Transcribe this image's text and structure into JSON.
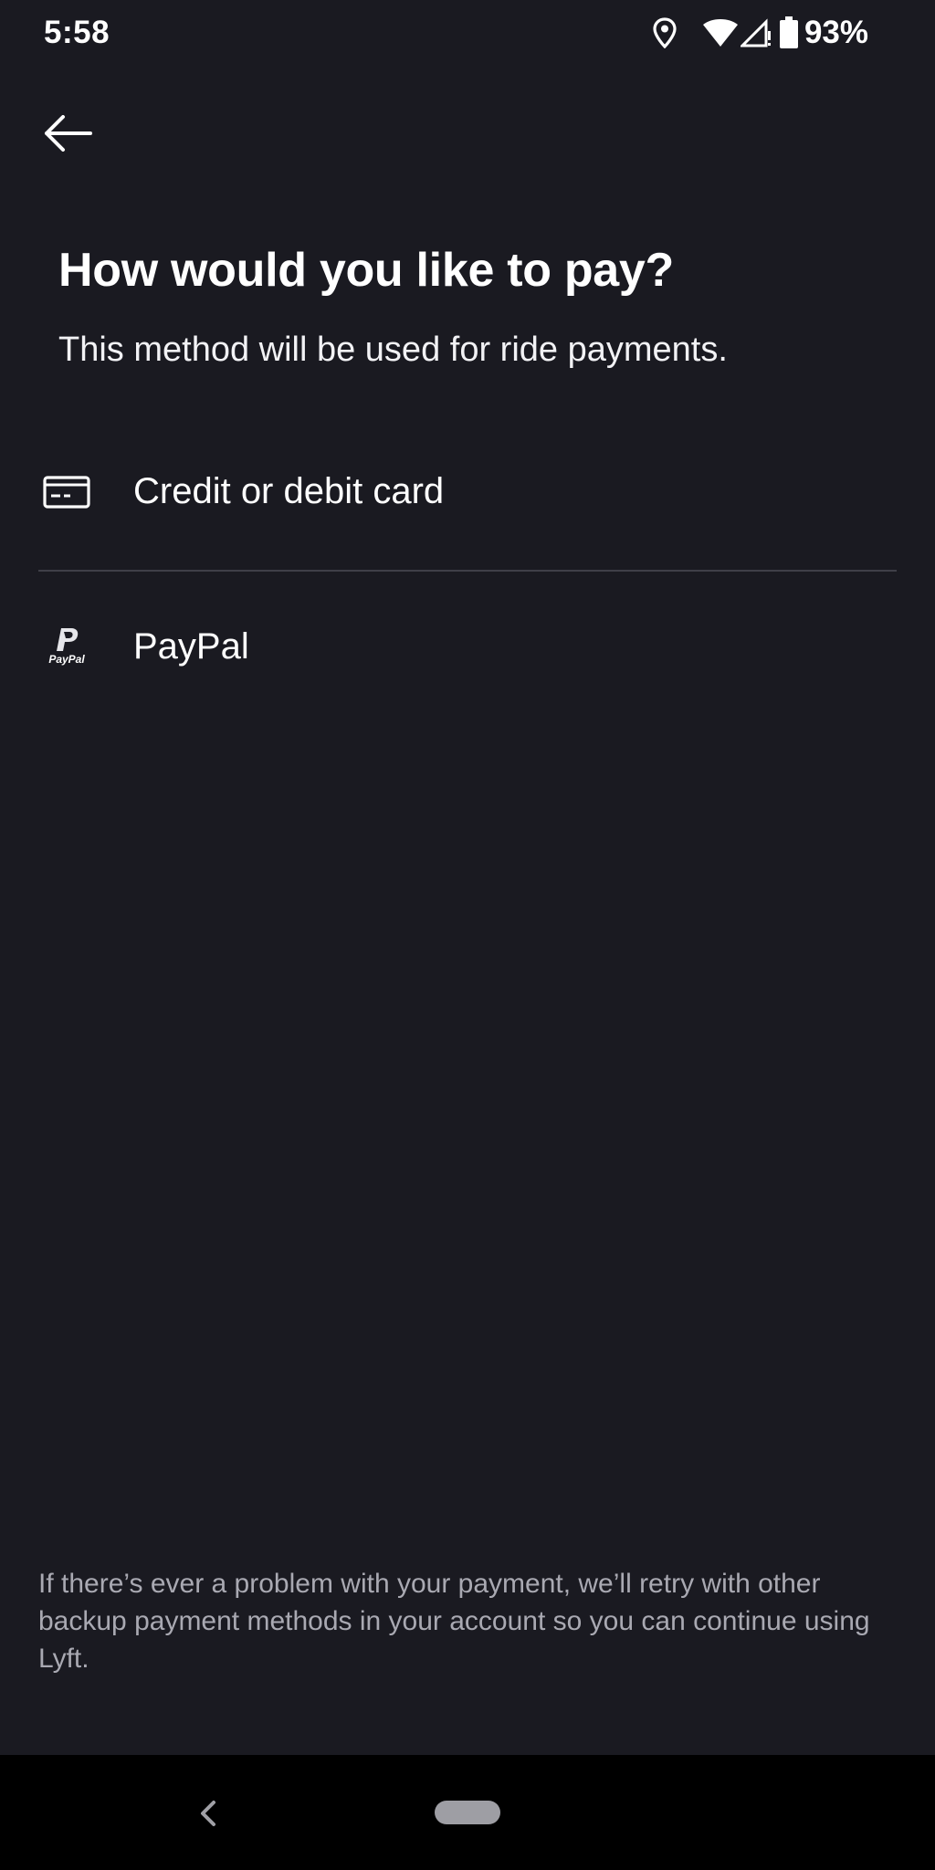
{
  "status_bar": {
    "time": "5:58",
    "battery_percent": "93%",
    "icons": [
      "location-icon",
      "wifi-icon",
      "cellular-signal-icon",
      "battery-icon"
    ]
  },
  "header": {
    "back_icon": "arrow-left-icon"
  },
  "main": {
    "title": "How would you like to pay?",
    "subtitle": "This method will be used for ride payments.",
    "payment_options": [
      {
        "label": "Credit or debit card",
        "icon": "credit-card-icon"
      },
      {
        "label": "PayPal",
        "icon": "paypal-icon",
        "icon_text": "PayPal"
      }
    ]
  },
  "footer": {
    "note": "If there’s ever a problem with your payment, we’ll retry with other backup payment methods in your account so you can continue using Lyft."
  },
  "nav_bar": {
    "icons": [
      "nav-back-icon",
      "home-pill-icon"
    ]
  },
  "colors": {
    "background": "#1a1a21",
    "text_primary": "#ffffff",
    "text_secondary": "#a9a9b2",
    "divider": "#3f3f48",
    "nav_bar": "#000000"
  }
}
